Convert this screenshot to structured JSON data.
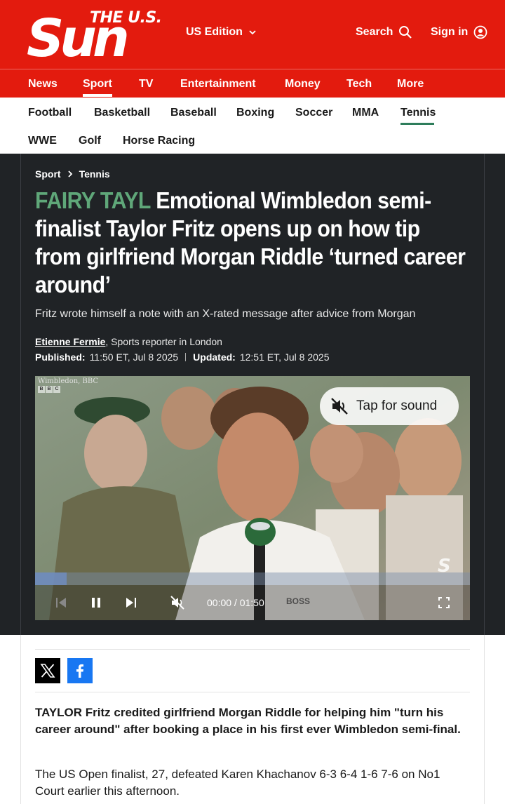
{
  "masthead": {
    "logo_top": "THE U.S.",
    "logo_main": "Sun",
    "edition_label": "US Edition",
    "search_label": "Search",
    "signin_label": "Sign in"
  },
  "section_nav": {
    "items": [
      "News",
      "Sport",
      "TV",
      "Entertainment",
      "Money",
      "Tech",
      "More"
    ],
    "active": "Sport"
  },
  "sub_nav": {
    "items": [
      "Football",
      "Basketball",
      "Baseball",
      "Boxing",
      "Soccer",
      "MMA",
      "Tennis",
      "WWE",
      "Golf",
      "Horse Racing"
    ],
    "active": "Tennis"
  },
  "article": {
    "breadcrumb": [
      "Sport",
      "Tennis"
    ],
    "kicker": "FAIRY TAYL",
    "headline": "Emotional Wimbledon semi-finalist Taylor Fritz opens up on how tip from girlfriend Morgan Riddle ‘turned career around’",
    "standfirst": "Fritz wrote himself a note with an X-rated message after advice from Morgan",
    "author": "Etienne Fermie",
    "author_role": ", Sports reporter in London",
    "published_label": "Published:",
    "published_value": "11:50 ET, Jul 8 2025",
    "updated_label": "Updated:",
    "updated_value": "12:51 ET, Jul 8 2025",
    "lede": "TAYLOR Fritz credited girlfriend Morgan Riddle for helping him \"turn his career around\" after booking a place in his first ever Wimbledon semi-final.",
    "paragraph_1": "The US Open finalist, 27, defeated Karen Khachanov 6-3 6-4 1-6 7-6 on No1 Court earlier this afternoon."
  },
  "video": {
    "watermark": "Wimbledon, BBC",
    "tap_for_sound": "Tap for sound",
    "time_display": "00:00 / 01:50",
    "progress_fraction": 0.072,
    "sponsor_text": "BOSS"
  },
  "colors": {
    "brand_red": "#e31b0e",
    "kicker_green": "#5fa779",
    "dark_bg": "#202326",
    "tennis_underline": "#2e7d5b",
    "facebook_blue": "#1877f2"
  },
  "icons": [
    "chevron-down-icon",
    "search-icon",
    "user-circle-icon",
    "chevron-right-icon",
    "muted-speaker-icon",
    "skip-back-icon",
    "pause-icon",
    "skip-forward-icon",
    "fullscreen-icon",
    "x-logo-icon",
    "facebook-logo-icon"
  ]
}
